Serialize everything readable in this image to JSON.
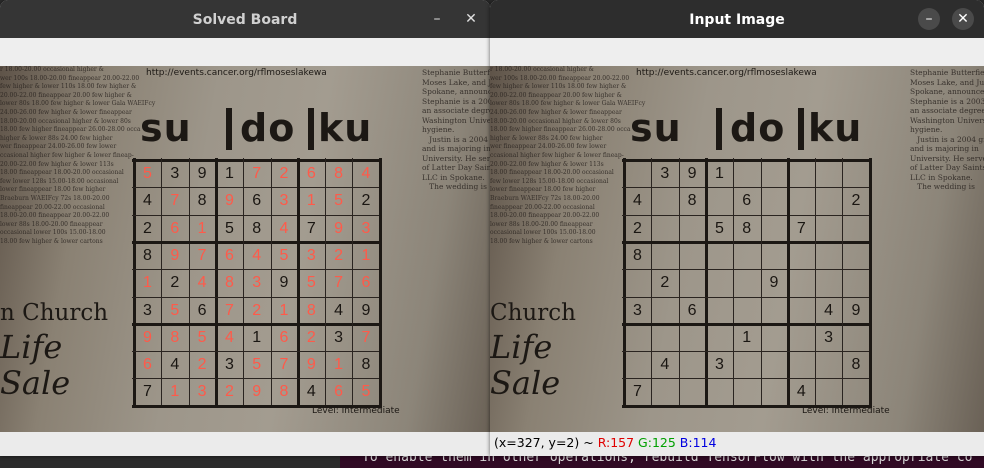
{
  "terminal": {
    "text": "To enable them in other operations, rebuild TensorFlow with the appropriate co"
  },
  "windows": {
    "left": {
      "title": "Solved Board",
      "minimize": "–",
      "close": "✕",
      "status": ""
    },
    "right": {
      "title": "Input Image",
      "minimize": "–",
      "close": "✕",
      "status": {
        "coords": "(x=327, y=2) ~",
        "r": "R:157",
        "g": "G:125",
        "b": "B:114"
      }
    }
  },
  "newspaper": {
    "url": "http://events.cancer.org/rflmoseslakewa",
    "title_parts": [
      "su",
      "do",
      "ku"
    ],
    "level": "Level: Intermediate",
    "church": [
      "n Church",
      "Life",
      "Sale"
    ],
    "church_right": [
      "Church",
      "Life",
      "Sale"
    ],
    "side_text_left": "r 18.00-20.00 occasional higher &\nwer 100s 18.00-20.00 fineappear 20.00-22.00\nfew higher & lower 110s 18.00 few higher &\n20.00-22.00 fineappear 20.00 few higher &\nlower 80s 18.00 few higher & lower Gala WAEIFcy\n24.00-26.00 few higher & lower fineappear\n18.00-20.00 occasional higher & lower 80s\n18.00 few higher fineappear 26.00-28.00 occa\nhigher & lower 88s 24.00 few higher\nwer fineappear 24.00-26.00 few lower\nccasional higher few higher & lower fineap-\n20.00-22.00 few higher & lower 113s\n18.00 fineappear 18.00-20.00 occasional\nfew lower 128s 15.00-18.00 occasional\nlower fineappear 18.00 few higher\nBraeburn WAEIFcy 72s 18.00-20.00\nfineappear 20.00-22.00 occasional\n18.00-20.00 fineappear 20.00-22.00\nlower 88s 18.00-20.00 fineappear\noccasional lower 100s 15.00-18.00\n18.00 few higher & lower cartons",
    "side_text_right": "Stephanie Butterfield\nMoses Lake, and Justin\nSpokane, announce their\nStephanie is a 2003\nan associate degree from\nWashington University\nhygiene.\n   Justin is a 2004 gr\nand is majoring in\nUniversity. He serves\nof Latter Day Saints\nLLC in Spokane.\n   The wedding is"
  },
  "boards": {
    "solved": [
      [
        5,
        3,
        9,
        1,
        7,
        2,
        6,
        8,
        4
      ],
      [
        4,
        7,
        8,
        9,
        6,
        3,
        1,
        5,
        2
      ],
      [
        2,
        6,
        1,
        5,
        8,
        4,
        7,
        9,
        3
      ],
      [
        8,
        9,
        7,
        6,
        4,
        5,
        3,
        2,
        1
      ],
      [
        1,
        2,
        4,
        8,
        3,
        9,
        5,
        7,
        6
      ],
      [
        3,
        5,
        6,
        7,
        2,
        1,
        8,
        4,
        9
      ],
      [
        9,
        8,
        5,
        4,
        1,
        6,
        2,
        3,
        7
      ],
      [
        6,
        4,
        2,
        3,
        5,
        7,
        9,
        1,
        8
      ],
      [
        7,
        1,
        3,
        2,
        9,
        8,
        4,
        6,
        5
      ]
    ],
    "input": [
      [
        0,
        3,
        9,
        1,
        0,
        0,
        0,
        0,
        0
      ],
      [
        4,
        0,
        8,
        0,
        6,
        0,
        0,
        0,
        2
      ],
      [
        2,
        0,
        0,
        5,
        8,
        0,
        7,
        0,
        0
      ],
      [
        8,
        0,
        0,
        0,
        0,
        0,
        0,
        0,
        0
      ],
      [
        0,
        2,
        0,
        0,
        0,
        9,
        0,
        0,
        0
      ],
      [
        3,
        0,
        6,
        0,
        0,
        0,
        0,
        4,
        9
      ],
      [
        0,
        0,
        0,
        0,
        1,
        0,
        0,
        3,
        0
      ],
      [
        0,
        4,
        0,
        3,
        0,
        0,
        0,
        0,
        8
      ],
      [
        7,
        0,
        0,
        0,
        0,
        0,
        4,
        0,
        0
      ]
    ]
  },
  "colors": {
    "solved_digit": "#ff5a4a",
    "given_digit": "#1a1612"
  }
}
